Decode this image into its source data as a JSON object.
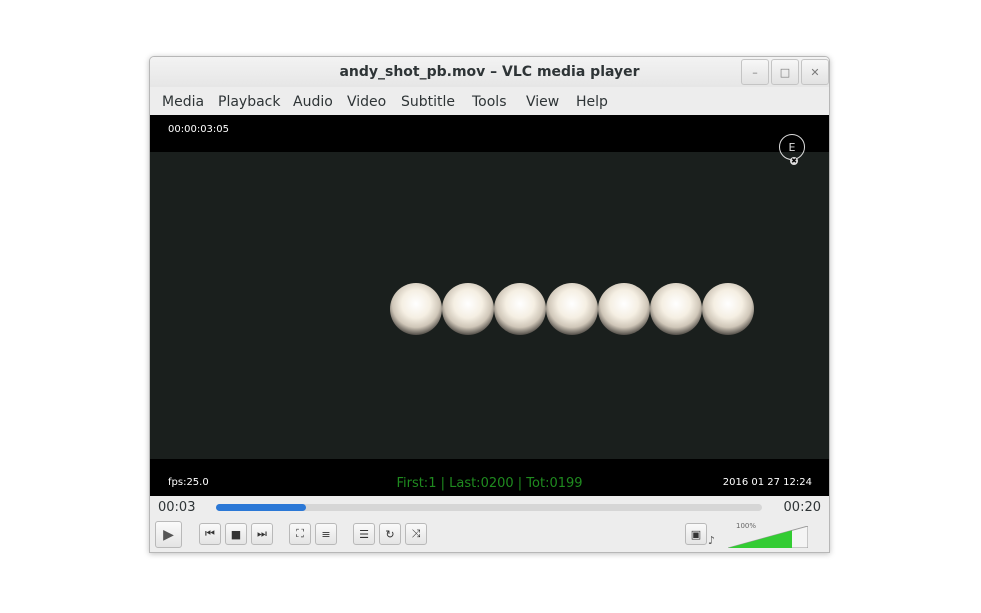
{
  "window": {
    "title": "andy_shot_pb.mov – VLC media player",
    "buttons": {
      "minimize": "–",
      "maximize": "□",
      "close": "✕"
    }
  },
  "menu": [
    "Media",
    "Playback",
    "Audio",
    "Video",
    "Subtitle",
    "Tools",
    "View",
    "Help"
  ],
  "overlay": {
    "timecode": "00:00:03:05",
    "fps": "fps:25.0",
    "frames": "First:1 | Last:0200 | Tot:0199",
    "date": "2016 01 27 12:24",
    "logo_glyph": "E",
    "logo_badge": "✖"
  },
  "seek": {
    "elapsed": "00:03",
    "total": "00:20",
    "progress_fraction": 0.165
  },
  "controls": {
    "play_icon": "▶",
    "prev_icon": "⏮",
    "stop_icon": "■",
    "next_icon": "⏭",
    "fullscreen_icon": "⛶",
    "extended_icon": "≡",
    "playlist_icon": "☰",
    "loop_icon": "↻",
    "random_icon": "⤨",
    "snapshot_icon": "▣",
    "speaker_icon": "♪"
  },
  "volume": {
    "label": "100%",
    "level": 1.0,
    "color": "#33cc33"
  }
}
